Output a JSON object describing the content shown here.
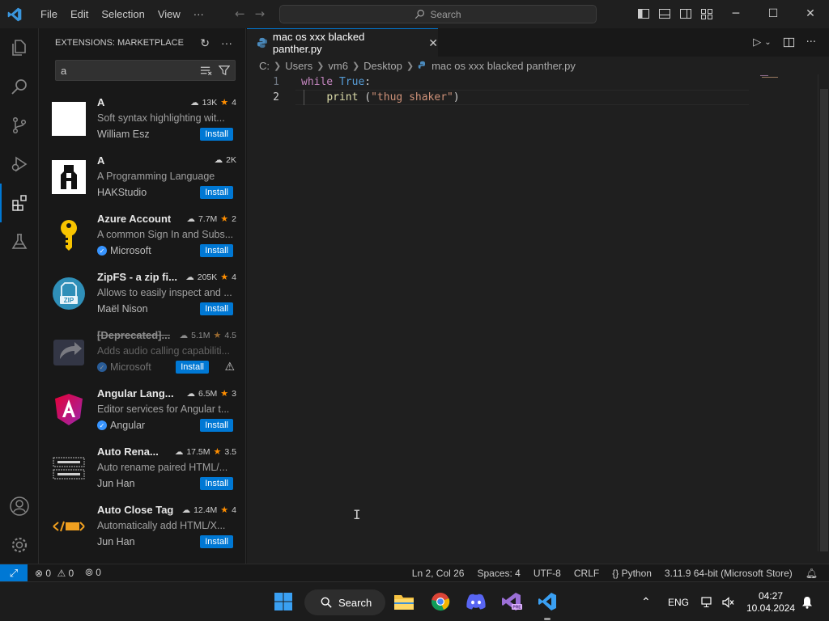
{
  "titlebar": {
    "menu": [
      "File",
      "Edit",
      "Selection",
      "View",
      "···"
    ],
    "search_placeholder": "Search",
    "window_controls": [
      "minimize-icon",
      "maximize-icon",
      "close-icon"
    ]
  },
  "activity_bar": {
    "items": [
      "explorer-icon",
      "search-icon",
      "source-control-icon",
      "run-debug-icon",
      "extensions-icon",
      "testing-icon"
    ],
    "bottom": [
      "account-icon",
      "settings-gear-icon"
    ],
    "active": "extensions-icon"
  },
  "sidebar": {
    "title": "EXTENSIONS: MARKETPLACE",
    "search_value": "a",
    "extensions": [
      {
        "name": "A",
        "downloads": "13K",
        "rating": "4",
        "description": "Soft syntax highlighting wit...",
        "publisher": "William Esz",
        "verified": false,
        "action": "Install",
        "deprecated": false
      },
      {
        "name": "A",
        "downloads": "2K",
        "rating": "",
        "description": "A Programming Language",
        "publisher": "HAKStudio",
        "verified": false,
        "action": "Install",
        "deprecated": false
      },
      {
        "name": "Azure Account",
        "downloads": "7.7M",
        "rating": "2",
        "description": "A common Sign In and Subs...",
        "publisher": "Microsoft",
        "verified": true,
        "action": "Install",
        "deprecated": false
      },
      {
        "name": "ZipFS - a zip fi...",
        "downloads": "205K",
        "rating": "4",
        "description": "Allows to easily inspect and ...",
        "publisher": "Maël Nison",
        "verified": false,
        "action": "Install",
        "deprecated": false
      },
      {
        "name": "[Deprecated]...",
        "downloads": "5.1M",
        "rating": "4.5",
        "description": "Adds audio calling capabiliti...",
        "publisher": "Microsoft",
        "verified": true,
        "action": "Install",
        "deprecated": true
      },
      {
        "name": "Angular Lang...",
        "downloads": "6.5M",
        "rating": "3",
        "description": "Editor services for Angular t...",
        "publisher": "Angular",
        "verified": true,
        "action": "Install",
        "deprecated": false
      },
      {
        "name": "Auto Rena...",
        "downloads": "17.5M",
        "rating": "3.5",
        "description": "Auto rename paired HTML/...",
        "publisher": "Jun Han",
        "verified": false,
        "action": "Install",
        "deprecated": false
      },
      {
        "name": "Auto Close Tag",
        "downloads": "12.4M",
        "rating": "4",
        "description": "Automatically add HTML/X...",
        "publisher": "Jun Han",
        "verified": false,
        "action": "Install",
        "deprecated": false
      }
    ]
  },
  "editor": {
    "tab_label": "mac os xxx blacked panther.py",
    "breadcrumb": [
      "C:",
      "Users",
      "vm6",
      "Desktop",
      "mac os xxx blacked panther.py"
    ],
    "lines": [
      {
        "num": "1",
        "kw": "while",
        "const": "True",
        "punc": ":"
      },
      {
        "num": "2",
        "indent": "    ",
        "fn": "print",
        "open": " (",
        "str": "\"thug shaker\"",
        "close": ")"
      }
    ]
  },
  "statusbar": {
    "errors": "0",
    "warnings": "0",
    "ports": "0",
    "position": "Ln 2, Col 26",
    "spaces": "Spaces: 4",
    "encoding": "UTF-8",
    "eol": "CRLF",
    "language": "Python",
    "interpreter": "3.11.9 64-bit (Microsoft Store)"
  },
  "taskbar": {
    "search_label": "Search",
    "language": "ENG",
    "time": "04:27",
    "date": "10.04.2024"
  }
}
